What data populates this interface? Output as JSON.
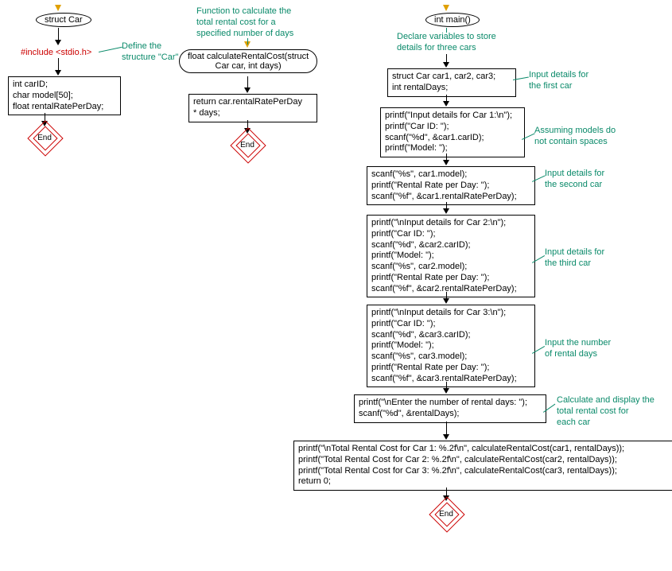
{
  "col1": {
    "struct_title": "struct Car",
    "include": "#include <stdio.h>",
    "comment_define": "Define the\nstructure \"Car\"",
    "struct_body": "int carID;\nchar model[50];\nfloat rentalRatePerDay;",
    "end": "End"
  },
  "col2": {
    "comment_func": "Function to calculate the\ntotal rental cost for a\nspecified number of days",
    "func_header": "float calculateRentalCost(struct\nCar car, int days)",
    "func_body": "return car.rentalRatePerDay\n* days;",
    "end": "End"
  },
  "col3": {
    "main_title": "int main()",
    "comment_declare": "Declare variables to store\ndetails for three cars",
    "declare": "struct Car car1, car2, car3;\nint rentalDays;",
    "comment_input1": "Input details for\nthe first car",
    "block_input1a": "printf(\"Input details for Car 1:\\n\");\nprintf(\"Car ID: \");\nscanf(\"%d\", &car1.carID);\nprintf(\"Model: \");",
    "comment_assume": "Assuming models do\nnot contain spaces",
    "block_input1b": "scanf(\"%s\", car1.model);\nprintf(\"Rental Rate per Day: \");\nscanf(\"%f\", &car1.rentalRatePerDay);",
    "comment_input2": "Input details for\nthe second car",
    "block_input2": "printf(\"\\nInput details for Car 2:\\n\");\nprintf(\"Car ID: \");\nscanf(\"%d\", &car2.carID);\nprintf(\"Model: \");\nscanf(\"%s\", car2.model);\nprintf(\"Rental Rate per Day: \");\nscanf(\"%f\", &car2.rentalRatePerDay);",
    "comment_input3": "Input details for\nthe third car",
    "block_input3": "printf(\"\\nInput details for Car 3:\\n\");\nprintf(\"Car ID: \");\nscanf(\"%d\", &car3.carID);\nprintf(\"Model: \");\nscanf(\"%s\", car3.model);\nprintf(\"Rental Rate per Day: \");\nscanf(\"%f\", &car3.rentalRatePerDay);",
    "comment_days": "Input the number\nof rental days",
    "block_days": "printf(\"\\nEnter the number of rental days: \");\nscanf(\"%d\", &rentalDays);",
    "comment_calc": "Calculate and display the\ntotal rental cost for\neach car",
    "block_calc": "printf(\"\\nTotal Rental Cost for Car 1: %.2f\\n\", calculateRentalCost(car1, rentalDays));\nprintf(\"Total Rental Cost for Car 2: %.2f\\n\", calculateRentalCost(car2, rentalDays));\nprintf(\"Total Rental Cost for Car 3: %.2f\\n\", calculateRentalCost(car3, rentalDays));\nreturn 0;",
    "end": "End"
  }
}
